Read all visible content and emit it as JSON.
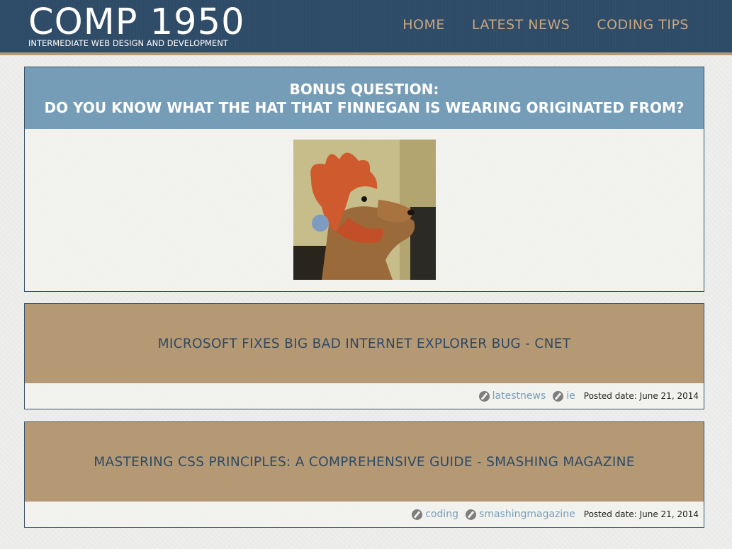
{
  "header": {
    "title": "COMP 1950",
    "subtitle": "INTERMEDIATE WEB DESIGN AND DEVELOPMENT",
    "nav": [
      "HOME",
      "LATEST NEWS",
      "CODING TIPS"
    ]
  },
  "bonus": {
    "line1": "BONUS QUESTION:",
    "line2": "DO YOU KNOW WHAT THE HAT THAT FINNEGAN IS WEARING ORIGINATED FROM?"
  },
  "posts": [
    {
      "title": "MICROSOFT FIXES BIG BAD INTERNET EXPLORER BUG - CNET",
      "tags": [
        "latestnews",
        "ie"
      ],
      "posted": "Posted date: June 21, 2014"
    },
    {
      "title": "MASTERING CSS PRINCIPLES: A COMPREHENSIVE GUIDE - SMASHING MAGAZINE",
      "tags": [
        "coding",
        "smashingmagazine"
      ],
      "posted": "Posted date: June 21, 2014"
    }
  ],
  "colors": {
    "header_bg": "#2e4b67",
    "nav_text": "#c9a77f",
    "bonus_bg": "#769db8",
    "post_bg": "#b59975",
    "post_title": "#2f4a63",
    "tag_link": "#7aa0bd"
  },
  "icons": {
    "tag": "tag-icon"
  }
}
